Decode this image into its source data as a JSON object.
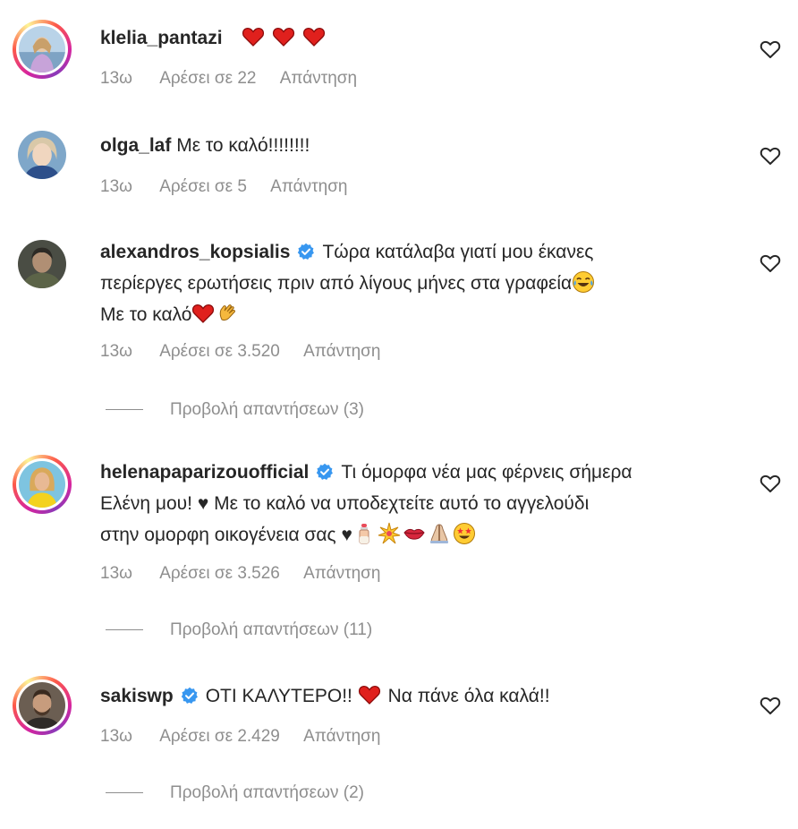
{
  "comments": [
    {
      "username": "klelia_pantazi",
      "text": "",
      "time": "13ω",
      "likes": "Αρέσει σε 22",
      "reply": "Απάντηση"
    },
    {
      "username": "olga_laf",
      "text": "Με το καλό!!!!!!!!",
      "time": "13ω",
      "likes": "Αρέσει σε 5",
      "reply": "Απάντηση"
    },
    {
      "username": "alexandros_kopsialis",
      "text_line1": "Τώρα κατάλαβα γιατί μου έκανες",
      "text_line2": "περίεργες ερωτήσεις πριν από λίγους μήνες στα γραφεία",
      "text_line3": "Με το καλό",
      "time": "13ω",
      "likes": "Αρέσει σε 3.520",
      "reply": "Απάντηση",
      "view_replies": "Προβολή απαντήσεων (3)"
    },
    {
      "username": "helenapaparizouofficial",
      "text_line1": "Τι όμορφα νέα μας φέρνεις σήμερα",
      "text_line2": "Ελένη μου! ♥ Με το καλό να υποδεχτείτε αυτό το αγγελούδι",
      "text_line3": "στην ομορφη οικογένεια σας ♥",
      "time": "13ω",
      "likes": "Αρέσει σε 3.526",
      "reply": "Απάντηση",
      "view_replies": "Προβολή απαντήσεων (11)"
    },
    {
      "username": "sakiswp",
      "text_a": "ΟΤΙ ΚΑΛΥΤΕΡΟ!!",
      "text_b": "Να πάνε όλα καλά!!",
      "time": "13ω",
      "likes": "Αρέσει σε 2.429",
      "reply": "Απάντηση",
      "view_replies": "Προβολή απαντήσεων (2)"
    }
  ],
  "icons": {
    "like": "heart-outline-icon",
    "verified": "verified-badge-icon"
  },
  "colors": {
    "text": "#262626",
    "secondary": "#8e8e8e",
    "verified": "#3897f0",
    "heart_emoji": "#e0201d"
  }
}
